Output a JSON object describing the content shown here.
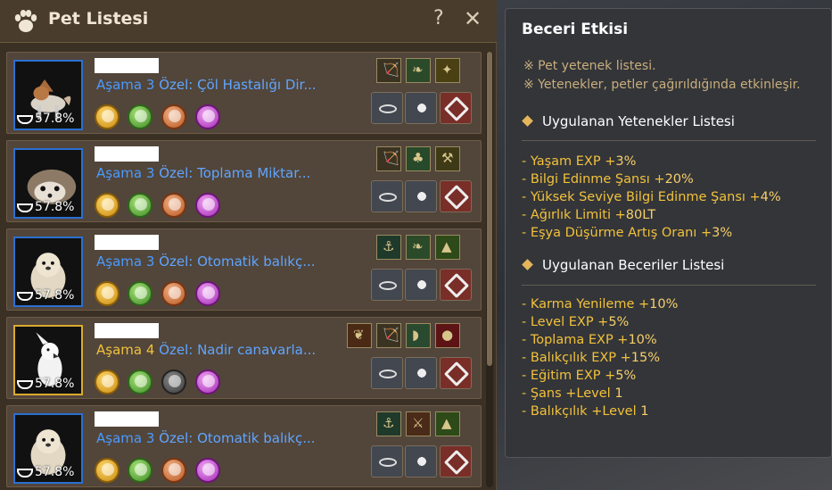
{
  "window": {
    "title": "Pet Listesi",
    "help": "?",
    "close": "✕"
  },
  "pets": [
    {
      "stage_label": "Aşama",
      "stage_num": "3",
      "special": "Özel: Çöl Hastalığı Dir...",
      "hunger": "57.8%",
      "tier": "blue",
      "portrait": "fox-dog",
      "skill_icons": [
        "ranged-skill-icon",
        "wing-skill-icon",
        "gather-skill-icon"
      ]
    },
    {
      "stage_label": "Aşama",
      "stage_num": "3",
      "special": "Özel: Toplama Miktar...",
      "hunger": "57.8%",
      "tier": "blue",
      "portrait": "hedgehog",
      "skill_icons": [
        "ranged-skill-icon",
        "clover-skill-icon",
        "pickaxe-skill-icon"
      ]
    },
    {
      "stage_label": "Aşama",
      "stage_num": "3",
      "special": "Özel: Otomatik balıkç...",
      "hunger": "57.8%",
      "tier": "blue",
      "portrait": "otter",
      "skill_icons": [
        "fishing-skill-icon",
        "wing-skill-icon",
        "weight-skill-icon"
      ]
    },
    {
      "stage_label": "Aşama",
      "stage_num": "4",
      "special": "Özel: Nadir canavarla...",
      "hunger": "57.8%",
      "tier": "gold",
      "portrait": "cockatoo",
      "skill_icons": [
        "leaf-skill-icon",
        "ranged-skill-icon",
        "horn-skill-icon",
        "red-skill-icon"
      ]
    },
    {
      "stage_label": "Aşama",
      "stage_num": "3",
      "special": "Özel: Otomatik balıkç...",
      "hunger": "57.8%",
      "tier": "blue",
      "portrait": "otter",
      "skill_icons": [
        "fishing-skill-icon",
        "axe-skill-icon",
        "weight-skill-icon"
      ]
    }
  ],
  "tooltip": {
    "title": "Beceri Etkisi",
    "notes": [
      "※ Pet yetenek listesi.",
      "※ Yetenekler, petler çağırıldığında etkinleşir."
    ],
    "talent_header": "Uygulanan Yetenekler Listesi",
    "talents": [
      {
        "name": "- Yaşam EXP +",
        "val": "3%"
      },
      {
        "name": "- Bilgi Edinme Şansı +",
        "val": "20%"
      },
      {
        "name": "- Yüksek Seviye Bilgi Edinme Şansı +",
        "val": "4%"
      },
      {
        "name": "- Ağırlık Limiti +",
        "val": "80LT"
      },
      {
        "name": "- Eşya Düşürme Artış Oranı +",
        "val": "3%"
      }
    ],
    "skill_header": "Uygulanan Beceriler Listesi",
    "skills": [
      {
        "name": "- Karma Yenileme +",
        "val": "10%"
      },
      {
        "name": "- Level EXP +",
        "val": "5%"
      },
      {
        "name": "- Toplama EXP +",
        "val": "10%"
      },
      {
        "name": "- Balıkçılık EXP +",
        "val": "15%"
      },
      {
        "name": "- Eğitim EXP +",
        "val": "5%"
      },
      {
        "name": "- Şans +Level ",
        "val": "1"
      },
      {
        "name": "- Balıkçılık +Level ",
        "val": "1"
      }
    ]
  }
}
